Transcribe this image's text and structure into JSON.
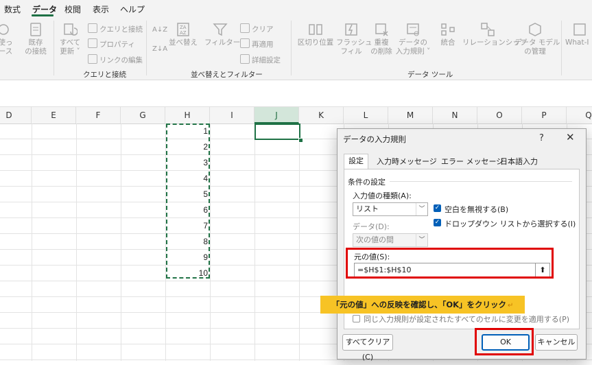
{
  "menu": {
    "tabs": [
      "数式",
      "データ",
      "校閲",
      "表示",
      "ヘルプ"
    ],
    "active": "データ"
  },
  "ribbon": {
    "cut_left_1": "使っ",
    "cut_left_2": "ース",
    "saved_conn_1": "既存",
    "saved_conn_2": "の接続",
    "refresh_all_1": "すべて",
    "refresh_all_2": "更新 ˅",
    "queries": "クエリと接続",
    "properties": "プロパティ",
    "edit_links": "リンクの編集",
    "group_queries": "クエリと接続",
    "sort": "並べ替え",
    "filter": "フィルター",
    "clear": "クリア",
    "reapply": "再適用",
    "advanced": "詳細設定",
    "group_sort_filter": "並べ替えとフィルター",
    "text_to_columns": "区切り位置",
    "flash_fill_1": "フラッシュ",
    "flash_fill_2": "フィル",
    "remove_dup_1": "重複",
    "remove_dup_2": "の削除",
    "validation_1": "データの",
    "validation_2": "入力規則 ˅",
    "consolidate": "統合",
    "relationships": "リレーションシップ",
    "data_model_1": "データ モデル",
    "data_model_2": "の管理",
    "what_if": "What-I",
    "group_data_tools": "データ ツール"
  },
  "columns": [
    "D",
    "E",
    "F",
    "G",
    "H",
    "I",
    "J",
    "K",
    "L",
    "M",
    "N",
    "O",
    "P",
    "Q"
  ],
  "selected_column": "J",
  "cells_H": [
    "1",
    "2",
    "3",
    "4",
    "5",
    "6",
    "7",
    "8",
    "9",
    "10"
  ],
  "dialog": {
    "title": "データの入力規則",
    "help": "?",
    "close": "✕",
    "tabs": [
      "設定",
      "入力時メッセージ",
      "エラー メッセージ",
      "日本語入力"
    ],
    "section": "条件の設定",
    "allow_label": "入力値の種類(A):",
    "allow_value": "リスト",
    "ignore_blank": "空白を無視する(B)",
    "dropdown": "ドロップダウン リストから選択する(I)",
    "data_label": "データ(D):",
    "data_value": "次の値の間",
    "source_label": "元の値(S):",
    "source_value": "=$H$1:$H$10",
    "apply_all": "同じ入力規則が設定されたすべてのセルに変更を適用する(P)",
    "clear_all": "すべてクリア(C)",
    "ok": "OK",
    "cancel": "キャンセル"
  },
  "callout": "「元の値」への反映を確認し、「OK」をクリック",
  "callout_mark": "↵",
  "colors": {
    "accent": "#1e7145",
    "highlight_red": "#e00000",
    "callout_yellow": "#f7c325",
    "checkbox_blue": "#005fb8"
  }
}
